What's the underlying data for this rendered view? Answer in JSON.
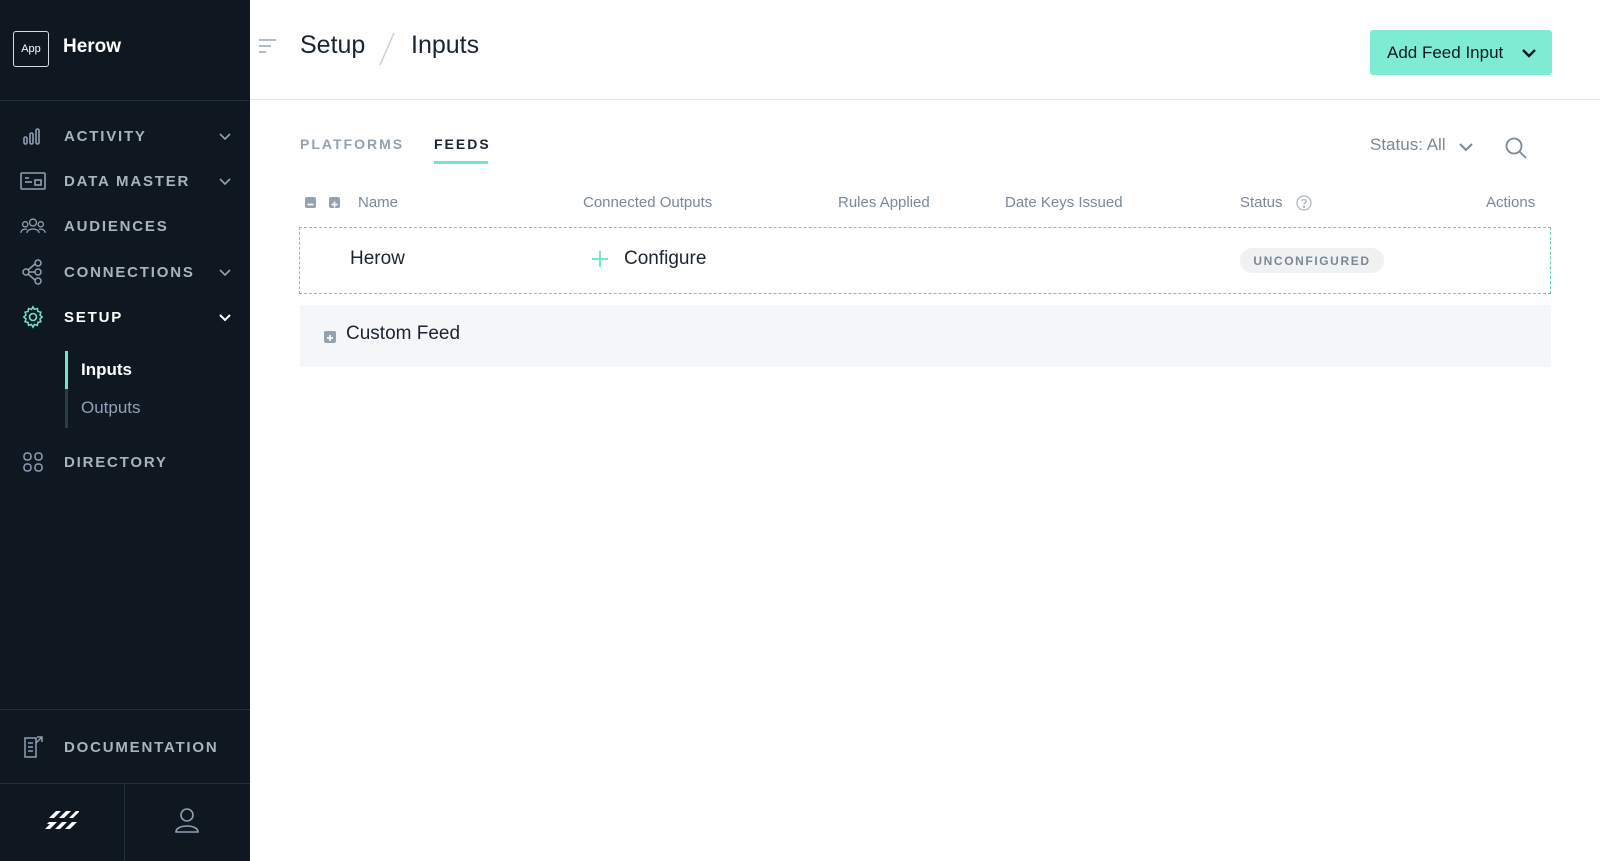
{
  "app": {
    "badge": "App",
    "name": "Herow"
  },
  "sidebar": {
    "items": [
      {
        "label": "ACTIVITY",
        "icon": "bar-chart-icon",
        "has_chevron": true
      },
      {
        "label": "DATA MASTER",
        "icon": "data-master-icon",
        "has_chevron": true
      },
      {
        "label": "AUDIENCES",
        "icon": "audiences-icon",
        "has_chevron": false
      },
      {
        "label": "CONNECTIONS",
        "icon": "connections-icon",
        "has_chevron": true
      },
      {
        "label": "SETUP",
        "icon": "gear-icon",
        "has_chevron": true,
        "active": true
      },
      {
        "label": "DIRECTORY",
        "icon": "grid-icon",
        "has_chevron": false
      }
    ],
    "setup_subitems": [
      {
        "label": "Inputs",
        "active": true
      },
      {
        "label": "Outputs",
        "active": false
      }
    ],
    "documentation": {
      "label": "DOCUMENTATION",
      "icon": "document-icon"
    },
    "bottom": {
      "logo_icon": "brand-logo-icon",
      "user_icon": "user-icon"
    }
  },
  "header": {
    "breadcrumb": [
      "Setup",
      "Inputs"
    ],
    "add_button": "Add Feed Input"
  },
  "tabs": [
    {
      "label": "PLATFORMS",
      "active": false
    },
    {
      "label": "FEEDS",
      "active": true
    }
  ],
  "filter": {
    "status_label": "Status: All"
  },
  "table": {
    "columns": [
      "Name",
      "Connected Outputs",
      "Rules Applied",
      "Date Keys Issued",
      "Status",
      "Actions"
    ],
    "rows": [
      {
        "name": "Herow",
        "connected_outputs": "Configure",
        "status": "UNCONFIGURED"
      }
    ],
    "groups": [
      {
        "label": "Custom Feed",
        "collapsed": true
      }
    ]
  },
  "colors": {
    "sidebar_bg": "#0f1821",
    "accent": "#70e6cf",
    "button_bg": "#7eecd2",
    "muted_text": "#7b8895"
  }
}
